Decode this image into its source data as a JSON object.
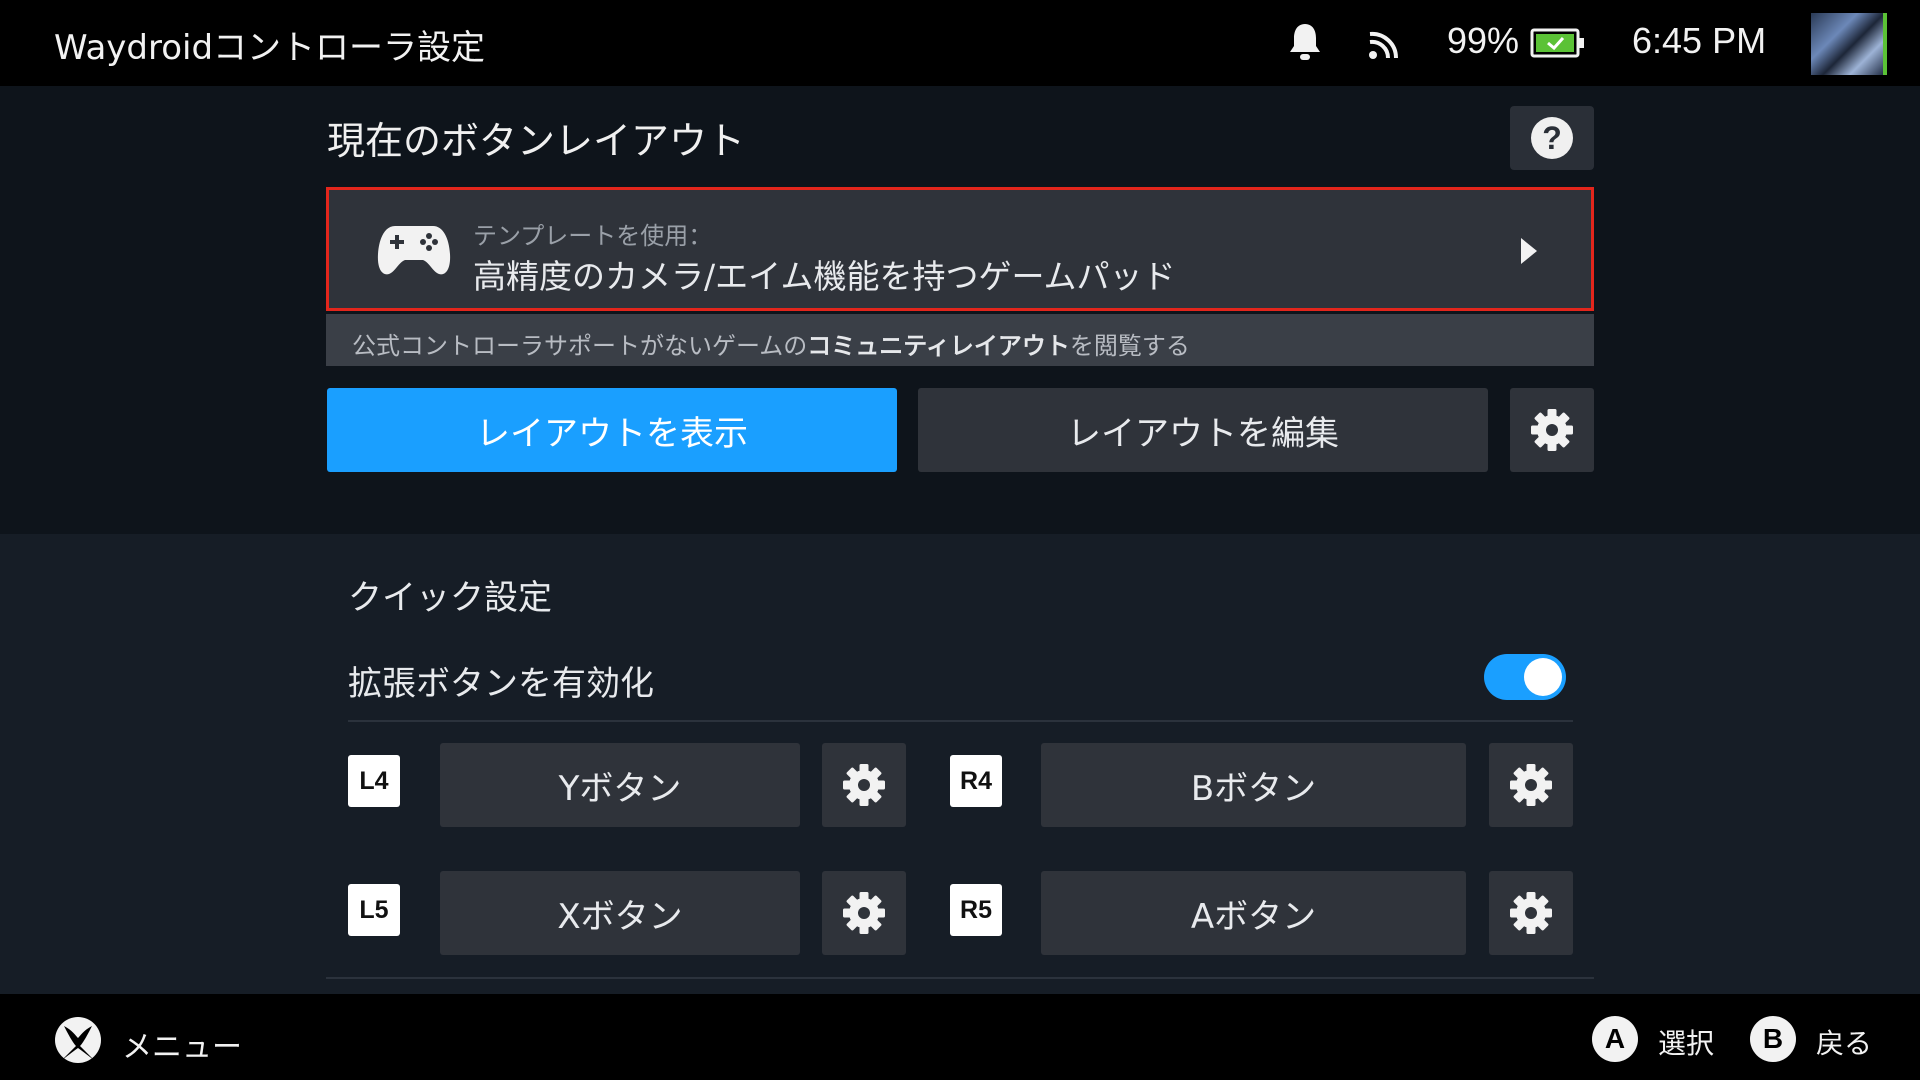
{
  "status_bar": {
    "app_title": "Waydroidコントローラ設定",
    "battery_percent": "99%",
    "clock": "6:45 PM"
  },
  "layout_section": {
    "title": "現在のボタンレイアウト",
    "template_label": "テンプレートを使用：",
    "template_name": "高精度のカメラ/エイム機能を持つゲームパッド",
    "community_prefix": "公式コントローラサポートがないゲームの",
    "community_link": "コミュニティレイアウト",
    "community_suffix": "を閲覧する",
    "show_layout_label": "レイアウトを表示",
    "edit_layout_label": "レイアウトを編集"
  },
  "quick_settings": {
    "title": "クイック設定",
    "enable_extended_label": "拡張ボタンを有効化",
    "enable_extended_on": true,
    "mappings": [
      {
        "badge": "L4",
        "action": "Yボタン"
      },
      {
        "badge": "R4",
        "action": "Bボタン"
      },
      {
        "badge": "L5",
        "action": "Xボタン"
      },
      {
        "badge": "R5",
        "action": "Aボタン"
      }
    ]
  },
  "footer": {
    "menu_label": "メニュー",
    "select_button": "A",
    "select_label": "選択",
    "back_button": "B",
    "back_label": "戻る"
  },
  "colors": {
    "accent_blue": "#1a9fff",
    "focus_outline": "#e3261c",
    "battery_green": "#5bc236"
  },
  "icons": [
    "bell-icon",
    "cast-icon",
    "battery-icon",
    "help-icon",
    "gamepad-icon",
    "chevron-right-icon",
    "gear-icon",
    "xbox-icon"
  ]
}
